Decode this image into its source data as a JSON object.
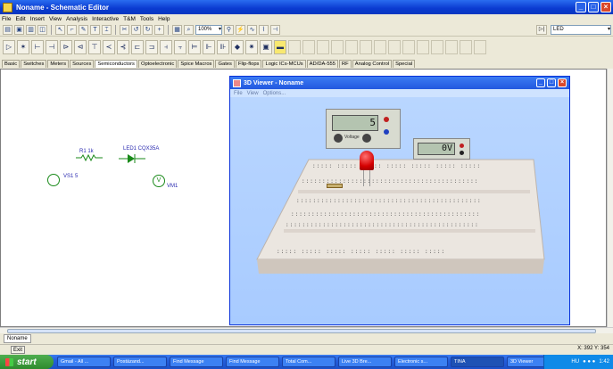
{
  "window": {
    "title": "Noname - Schematic Editor"
  },
  "menu": [
    "File",
    "Edit",
    "Insert",
    "View",
    "Analysis",
    "Interactive",
    "T&M",
    "Tools",
    "Help"
  ],
  "toolbar": {
    "zoom": "100%",
    "component_search": "LED"
  },
  "component_tabs": [
    "Basic",
    "Switches",
    "Meters",
    "Sources",
    "Semiconductors",
    "Optoelectronic",
    "Spice Macros",
    "Gates",
    "Flip-flops",
    "Logic ICs-MCUs",
    "AD/DA-555",
    "RF",
    "Analog Control",
    "Special"
  ],
  "active_tab": "Semiconductors",
  "schematic": {
    "r1": "R1 1k",
    "led1": "LED1 CQX35A",
    "vs1": "VS1 5",
    "vm1": "VM1"
  },
  "viewer": {
    "title": "3D Viewer - Noname",
    "menu": [
      "File",
      "View",
      "Options..."
    ],
    "source_display": "5",
    "source_label": "Voltage",
    "meter_display": "0V"
  },
  "document_tab": "Noname",
  "status": {
    "exit": "Exit",
    "coords": "X: 392  Y: 354"
  },
  "taskbar": {
    "start": "start",
    "tasks": [
      "Gmail - All ...",
      "Postázand...",
      "Find Message",
      "Find Message",
      "Total Com...",
      "Live 3D Bre...",
      "Electronic s...",
      "TINA",
      "3D Viewer"
    ],
    "active_task": "TINA",
    "tray_lang": "HU",
    "clock": "1:42"
  }
}
